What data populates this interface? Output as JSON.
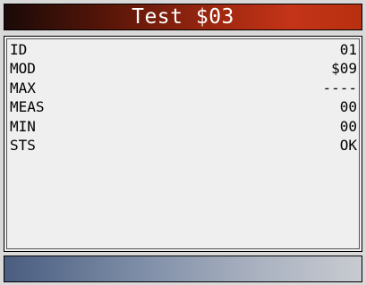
{
  "title": "Test $03",
  "rows": [
    {
      "label": "ID",
      "value": "01"
    },
    {
      "label": "MOD",
      "value": "$09"
    },
    {
      "label": "MAX",
      "value": "----"
    },
    {
      "label": "MEAS",
      "value": "00"
    },
    {
      "label": "MIN",
      "value": "00"
    },
    {
      "label": "STS",
      "value": "OK"
    }
  ],
  "colors": {
    "title_gradient_start": "#1a0a08",
    "title_gradient_end": "#c43418",
    "footer_gradient_start": "#4a5d80",
    "footer_gradient_end": "#c8cbd0"
  }
}
